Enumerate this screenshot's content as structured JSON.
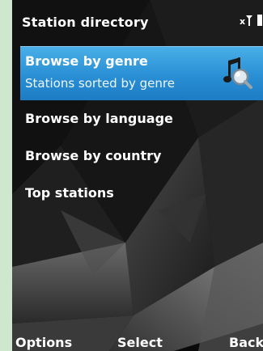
{
  "header": {
    "title": "Station directory"
  },
  "status": {
    "signal_icon": "signal-icon",
    "battery_icon": "battery-icon"
  },
  "menu": {
    "items": [
      {
        "label": "Browse by genre",
        "sublabel": "Stations sorted by genre",
        "icon": "music-search-icon",
        "selected": true
      },
      {
        "label": "Browse by language"
      },
      {
        "label": "Browse by country"
      },
      {
        "label": "Top stations"
      }
    ]
  },
  "softkeys": {
    "left": "Options",
    "middle": "Select",
    "right": "Back"
  },
  "colors": {
    "highlight": "#2a8fd4",
    "frame": "#cfe6cf",
    "background": "#0c0c0c"
  }
}
